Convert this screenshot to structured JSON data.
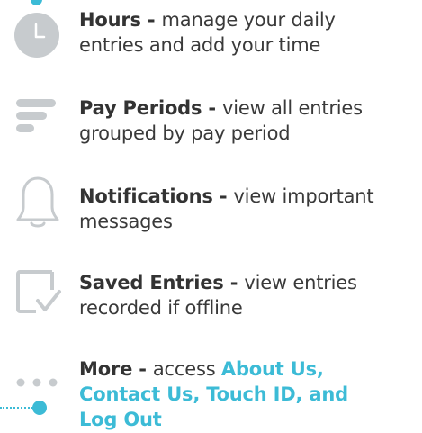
{
  "items": [
    {
      "title": "Hours - ",
      "line1": "manage your daily",
      "line2": "entries and add your time",
      "icon": "clock-icon"
    },
    {
      "title": "Pay Periods - ",
      "line1": "view all entries",
      "line2": "grouped by pay period",
      "icon": "list-icon"
    },
    {
      "title": "Notifications - ",
      "line1": "view important",
      "line2": "messages",
      "icon": "bell-icon"
    },
    {
      "title": "Saved Entries - ",
      "line1": "view entries",
      "line2": "recorded if offline",
      "icon": "saved-check-icon"
    },
    {
      "title": "More - ",
      "line1": "access ",
      "accent1": "About Us,",
      "accent2": "Contact Us, Touch ID, and",
      "accent3": "Log Out",
      "icon": "more-dots-icon"
    }
  ],
  "colors": {
    "accent": "#3cbbd6",
    "icon_gray": "#c7cbce",
    "text": "#333333"
  }
}
